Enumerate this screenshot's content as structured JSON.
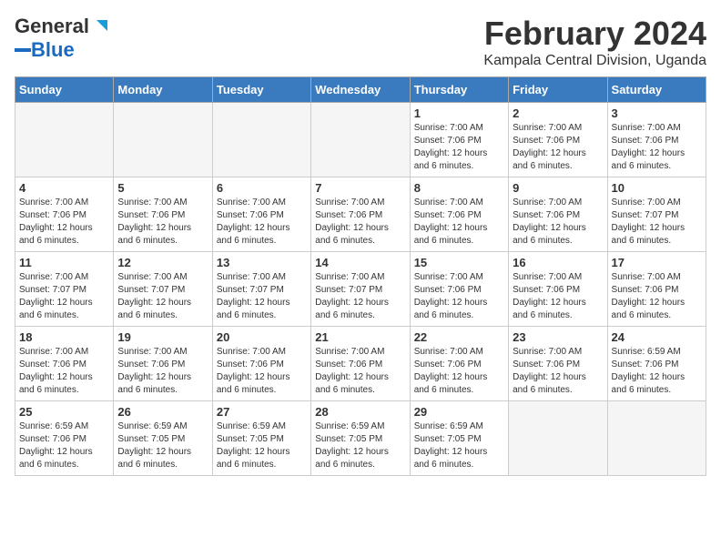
{
  "logo": {
    "text_general": "General",
    "text_blue": "Blue"
  },
  "title": "February 2024",
  "subtitle": "Kampala Central Division, Uganda",
  "header": {
    "days": [
      "Sunday",
      "Monday",
      "Tuesday",
      "Wednesday",
      "Thursday",
      "Friday",
      "Saturday"
    ]
  },
  "weeks": [
    [
      {
        "day": "",
        "info": ""
      },
      {
        "day": "",
        "info": ""
      },
      {
        "day": "",
        "info": ""
      },
      {
        "day": "",
        "info": ""
      },
      {
        "day": "1",
        "info": "Sunrise: 7:00 AM\nSunset: 7:06 PM\nDaylight: 12 hours\nand 6 minutes."
      },
      {
        "day": "2",
        "info": "Sunrise: 7:00 AM\nSunset: 7:06 PM\nDaylight: 12 hours\nand 6 minutes."
      },
      {
        "day": "3",
        "info": "Sunrise: 7:00 AM\nSunset: 7:06 PM\nDaylight: 12 hours\nand 6 minutes."
      }
    ],
    [
      {
        "day": "4",
        "info": "Sunrise: 7:00 AM\nSunset: 7:06 PM\nDaylight: 12 hours\nand 6 minutes."
      },
      {
        "day": "5",
        "info": "Sunrise: 7:00 AM\nSunset: 7:06 PM\nDaylight: 12 hours\nand 6 minutes."
      },
      {
        "day": "6",
        "info": "Sunrise: 7:00 AM\nSunset: 7:06 PM\nDaylight: 12 hours\nand 6 minutes."
      },
      {
        "day": "7",
        "info": "Sunrise: 7:00 AM\nSunset: 7:06 PM\nDaylight: 12 hours\nand 6 minutes."
      },
      {
        "day": "8",
        "info": "Sunrise: 7:00 AM\nSunset: 7:06 PM\nDaylight: 12 hours\nand 6 minutes."
      },
      {
        "day": "9",
        "info": "Sunrise: 7:00 AM\nSunset: 7:06 PM\nDaylight: 12 hours\nand 6 minutes."
      },
      {
        "day": "10",
        "info": "Sunrise: 7:00 AM\nSunset: 7:07 PM\nDaylight: 12 hours\nand 6 minutes."
      }
    ],
    [
      {
        "day": "11",
        "info": "Sunrise: 7:00 AM\nSunset: 7:07 PM\nDaylight: 12 hours\nand 6 minutes."
      },
      {
        "day": "12",
        "info": "Sunrise: 7:00 AM\nSunset: 7:07 PM\nDaylight: 12 hours\nand 6 minutes."
      },
      {
        "day": "13",
        "info": "Sunrise: 7:00 AM\nSunset: 7:07 PM\nDaylight: 12 hours\nand 6 minutes."
      },
      {
        "day": "14",
        "info": "Sunrise: 7:00 AM\nSunset: 7:07 PM\nDaylight: 12 hours\nand 6 minutes."
      },
      {
        "day": "15",
        "info": "Sunrise: 7:00 AM\nSunset: 7:06 PM\nDaylight: 12 hours\nand 6 minutes."
      },
      {
        "day": "16",
        "info": "Sunrise: 7:00 AM\nSunset: 7:06 PM\nDaylight: 12 hours\nand 6 minutes."
      },
      {
        "day": "17",
        "info": "Sunrise: 7:00 AM\nSunset: 7:06 PM\nDaylight: 12 hours\nand 6 minutes."
      }
    ],
    [
      {
        "day": "18",
        "info": "Sunrise: 7:00 AM\nSunset: 7:06 PM\nDaylight: 12 hours\nand 6 minutes."
      },
      {
        "day": "19",
        "info": "Sunrise: 7:00 AM\nSunset: 7:06 PM\nDaylight: 12 hours\nand 6 minutes."
      },
      {
        "day": "20",
        "info": "Sunrise: 7:00 AM\nSunset: 7:06 PM\nDaylight: 12 hours\nand 6 minutes."
      },
      {
        "day": "21",
        "info": "Sunrise: 7:00 AM\nSunset: 7:06 PM\nDaylight: 12 hours\nand 6 minutes."
      },
      {
        "day": "22",
        "info": "Sunrise: 7:00 AM\nSunset: 7:06 PM\nDaylight: 12 hours\nand 6 minutes."
      },
      {
        "day": "23",
        "info": "Sunrise: 7:00 AM\nSunset: 7:06 PM\nDaylight: 12 hours\nand 6 minutes."
      },
      {
        "day": "24",
        "info": "Sunrise: 6:59 AM\nSunset: 7:06 PM\nDaylight: 12 hours\nand 6 minutes."
      }
    ],
    [
      {
        "day": "25",
        "info": "Sunrise: 6:59 AM\nSunset: 7:06 PM\nDaylight: 12 hours\nand 6 minutes."
      },
      {
        "day": "26",
        "info": "Sunrise: 6:59 AM\nSunset: 7:05 PM\nDaylight: 12 hours\nand 6 minutes."
      },
      {
        "day": "27",
        "info": "Sunrise: 6:59 AM\nSunset: 7:05 PM\nDaylight: 12 hours\nand 6 minutes."
      },
      {
        "day": "28",
        "info": "Sunrise: 6:59 AM\nSunset: 7:05 PM\nDaylight: 12 hours\nand 6 minutes."
      },
      {
        "day": "29",
        "info": "Sunrise: 6:59 AM\nSunset: 7:05 PM\nDaylight: 12 hours\nand 6 minutes."
      },
      {
        "day": "",
        "info": ""
      },
      {
        "day": "",
        "info": ""
      }
    ]
  ]
}
